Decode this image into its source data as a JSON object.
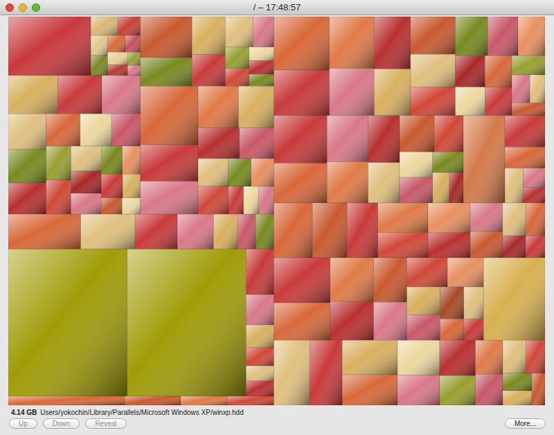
{
  "window": {
    "title": "/ – 17:48:57"
  },
  "treemap": {
    "children": [
      {
        "children": [
          {
            "children": [
              {
                "children": [
                  {
                    "children": [
                      {
                        "value": 1.15,
                        "color": "#c8383c"
                      },
                      {
                        "values": [
                          0.12,
                          0.1,
                          0.08,
                          0.08,
                          0.07,
                          0.06,
                          0.06,
                          0.05,
                          0.04,
                          0.03
                        ],
                        "colors": [
                          "#d8b878",
                          "#c8403a",
                          "#e0c890",
                          "#7a8a28",
                          "#d86a3a",
                          "#c85060",
                          "#e8d098",
                          "#b83a30",
                          "#98a038",
                          "#d87888"
                        ]
                      }
                    ]
                  },
                  {
                    "values": [
                      0.45,
                      0.4,
                      0.35,
                      0.32,
                      0.3,
                      0.28,
                      0.26,
                      0.24,
                      0.22,
                      0.2,
                      0.2,
                      0.18,
                      0.16,
                      0.15,
                      0.14,
                      0.12,
                      0.12,
                      0.1,
                      0.08,
                      0.07
                    ],
                    "colors": [
                      "#d8b060",
                      "#c83a3a",
                      "#d87888",
                      "#e0c080",
                      "#788a20",
                      "#b83030",
                      "#d8683a",
                      "#ecd8a0",
                      "#c85868",
                      "#98a030",
                      "#d04838",
                      "#e0c080",
                      "#a82828",
                      "#d87888",
                      "#788a20",
                      "#e89060",
                      "#c83a3a",
                      "#d8b060",
                      "#c85a30",
                      "#ecd8a0"
                    ]
                  }
                ]
              },
              {
                "children": [
                  {
                    "values": [
                      0.5,
                      0.35,
                      0.3,
                      0.25,
                      0.2,
                      0.15,
                      0.12,
                      0.1,
                      0.08,
                      0.08,
                      0.07
                    ],
                    "colors": [
                      "#c85a30",
                      "#788a20",
                      "#d8b060",
                      "#c83a3a",
                      "#e0c080",
                      "#d87888",
                      "#98a030",
                      "#d04838",
                      "#ecd8a0",
                      "#b83030",
                      "#788a20"
                    ]
                  },
                  {
                    "values": [
                      0.8,
                      0.5,
                      0.45,
                      0.4,
                      0.35,
                      0.3,
                      0.25,
                      0.2,
                      0.2,
                      0.15,
                      0.15,
                      0.1,
                      0.1,
                      0.1
                    ],
                    "colors": [
                      "#d8683a",
                      "#c83a3a",
                      "#d87888",
                      "#e07a48",
                      "#d8b060",
                      "#b83030",
                      "#c85868",
                      "#e0c080",
                      "#d04838",
                      "#788a20",
                      "#e89060",
                      "#c83a3a",
                      "#ecd8a0",
                      "#d87888"
                    ]
                  }
                ]
              }
            ]
          },
          {
            "values": [
              0.6,
              0.45,
              0.35,
              0.3,
              0.2,
              0.15,
              0.15
            ],
            "colors": [
              "#d8683a",
              "#e0c080",
              "#c83a3a",
              "#d87888",
              "#d8b060",
              "#c85868",
              "#788a20"
            ]
          },
          {
            "children": [
              {
                "value": 4.14,
                "color": "#a09c08"
              },
              {
                "value": 4.14,
                "color": "#a09c08"
              },
              {
                "values": [
                  0.3,
                  0.2,
                  0.15,
                  0.12,
                  0.1,
                  0.1
                ],
                "colors": [
                  "#c83a3a",
                  "#d87888",
                  "#d8b060",
                  "#d04838",
                  "#e0c080",
                  "#b83030"
                ]
              }
            ]
          },
          {
            "values": [
              0.25,
              0.12,
              0.1,
              0.1
            ],
            "colors": [
              "#d8683a",
              "#c85a30",
              "#e07a48",
              "#d04838"
            ]
          }
        ]
      },
      {
        "children": [
          {
            "values": [
              0.7,
              0.6,
              0.55,
              0.5,
              0.45,
              0.4,
              0.4,
              0.35,
              0.3,
              0.3,
              0.28,
              0.25,
              0.22,
              0.2,
              0.2,
              0.18,
              0.15,
              0.12,
              0.1,
              0.1
            ],
            "colors": [
              "#d8683a",
              "#c83a3a",
              "#e07a48",
              "#d87888",
              "#b83030",
              "#d8b060",
              "#c85a30",
              "#e0c080",
              "#d04838",
              "#788a20",
              "#c85868",
              "#e89060",
              "#a82828",
              "#ecd8a0",
              "#d8683a",
              "#c83a3a",
              "#98a030",
              "#d87888",
              "#e0c080",
              "#c85a30"
            ]
          },
          {
            "children": [
              {
                "values": [
                  0.6,
                  0.5,
                  0.45,
                  0.4,
                  0.35,
                  0.3,
                  0.3,
                  0.25,
                  0.2,
                  0.2,
                  0.15,
                  0.12,
                  0.1
                ],
                "colors": [
                  "#c83a3a",
                  "#d8683a",
                  "#d87888",
                  "#e07a48",
                  "#b83030",
                  "#e0c080",
                  "#c85a30",
                  "#d04838",
                  "#ecd8a0",
                  "#c85868",
                  "#788a20",
                  "#d8b060",
                  "#a82828"
                ]
              },
              {
                "value": 0.86,
                "color": "#d47a4a"
              },
              {
                "values": [
                  0.3,
                  0.2,
                  0.15,
                  0.1,
                  0.08
                ],
                "colors": [
                  "#c83a3a",
                  "#d8683a",
                  "#e0c080",
                  "#d87888",
                  "#b83030"
                ]
              }
            ]
          },
          {
            "values": [
              0.5,
              0.45,
              0.4,
              0.35,
              0.3,
              0.3,
              0.25,
              0.22,
              0.2,
              0.18,
              0.15,
              0.12,
              0.1
            ],
            "colors": [
              "#d8683a",
              "#c85a30",
              "#c83a3a",
              "#e07a48",
              "#d04838",
              "#e89060",
              "#b83030",
              "#d87888",
              "#c85a30",
              "#e0c080",
              "#d8683a",
              "#a82828",
              "#c83a3a"
            ]
          },
          {
            "children": [
              {
                "values": [
                  0.6,
                  0.5,
                  0.45,
                  0.4,
                  0.35,
                  0.3,
                  0.28,
                  0.25,
                  0.22,
                  0.2,
                  0.18,
                  0.15,
                  0.12,
                  0.1
                ],
                "colors": [
                  "#c83a3a",
                  "#d8683a",
                  "#e07a48",
                  "#b83030",
                  "#c85a30",
                  "#d87888",
                  "#d04838",
                  "#e89060",
                  "#d8b060",
                  "#c85868",
                  "#a84a28",
                  "#e0c080",
                  "#d8683a",
                  "#c83a3a"
                ]
              },
              {
                "value": 1.2,
                "color": "#d8b050"
              }
            ]
          },
          {
            "values": [
              0.55,
              0.5,
              0.45,
              0.4,
              0.35,
              0.3,
              0.3,
              0.25,
              0.22,
              0.2,
              0.18,
              0.15,
              0.12,
              0.1,
              0.1
            ],
            "colors": [
              "#e0c080",
              "#c83a3a",
              "#d8b060",
              "#d8683a",
              "#ecd8a0",
              "#d87888",
              "#b83030",
              "#98a030",
              "#e07a48",
              "#c85868",
              "#e0c080",
              "#d04838",
              "#788a20",
              "#d8b060",
              "#c85a30"
            ]
          }
        ]
      }
    ]
  },
  "status": {
    "size": "4.14 GB",
    "path": "Users/yokochin/Library/Parallels/Microsoft Windows XP/winxp.hdd"
  },
  "buttons": [
    {
      "label": "Up",
      "disabled": true
    },
    {
      "label": "Down",
      "disabled": true
    },
    {
      "label": "Reveal",
      "disabled": true
    }
  ],
  "more_button": {
    "label": "More...",
    "disabled": false
  }
}
